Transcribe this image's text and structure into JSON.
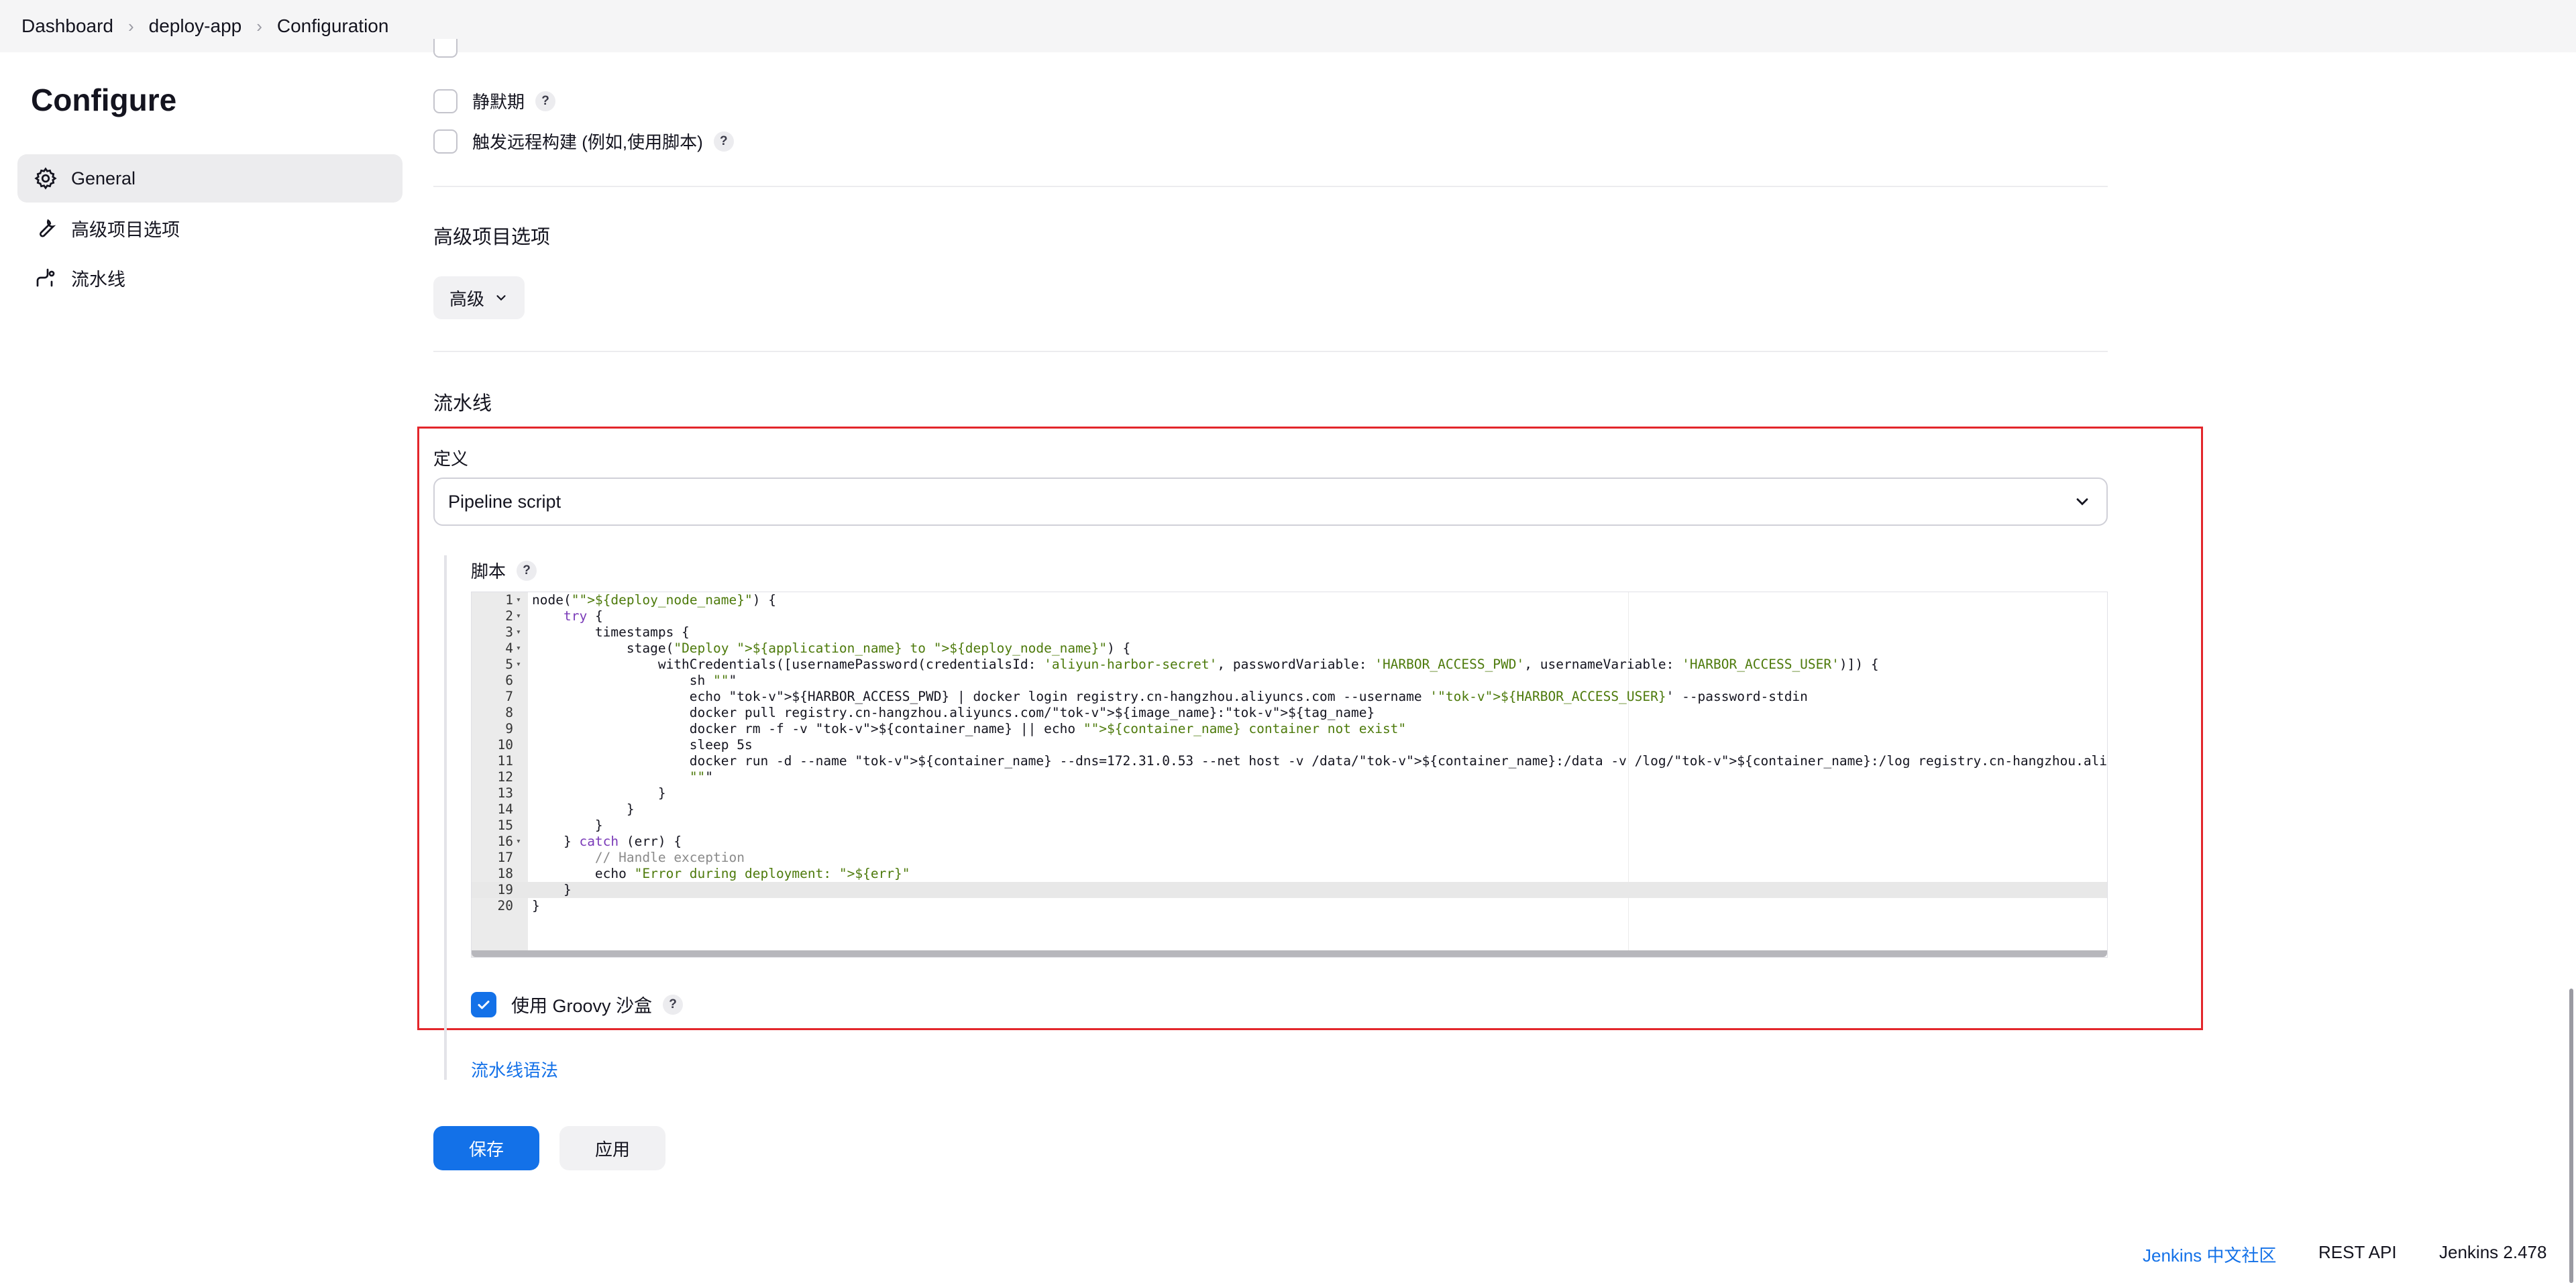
{
  "breadcrumb": {
    "items": [
      "Dashboard",
      "deploy-app",
      "Configuration"
    ]
  },
  "page_title": "Configure",
  "sidebar": {
    "items": [
      {
        "label": "General",
        "icon": "gear-icon",
        "active": true
      },
      {
        "label": "高级项目选项",
        "icon": "wrench-icon",
        "active": false
      },
      {
        "label": "流水线",
        "icon": "pipeline-icon",
        "active": false
      }
    ]
  },
  "triggers": {
    "quiet_period_label": "静默期",
    "remote_build_label": "触发远程构建 (例如,使用脚本)",
    "help_glyph": "?"
  },
  "advanced_section": {
    "title": "高级项目选项",
    "button_label": "高级"
  },
  "pipeline_section": {
    "title": "流水线",
    "definition_label": "定义",
    "definition_value": "Pipeline script",
    "script_label": "脚本",
    "sandbox_label": "使用 Groovy 沙盒",
    "sandbox_checked": true,
    "syntax_link": "流水线语法"
  },
  "editor": {
    "active_line": 19,
    "lines": [
      "node(\"${deploy_node_name}\") {",
      "    try {",
      "        timestamps {",
      "            stage(\"Deploy ${application_name} to ${deploy_node_name}\") {",
      "                withCredentials([usernamePassword(credentialsId: 'aliyun-harbor-secret', passwordVariable: 'HARBOR_ACCESS_PWD', usernameVariable: 'HARBOR_ACCESS_USER')]) {",
      "                    sh \"\"\"",
      "                    echo ${HARBOR_ACCESS_PWD} | docker login registry.cn-hangzhou.aliyuncs.com --username '${HARBOR_ACCESS_USER}' --password-stdin",
      "                    docker pull registry.cn-hangzhou.aliyuncs.com/${image_name}:${tag_name}",
      "                    docker rm -f -v ${container_name} || echo \"${container_name} container not exist\"",
      "                    sleep 5s",
      "                    docker run -d --name ${container_name} --dns=172.31.0.53 --net host -v /data/${container_name}:/data -v /log/${container_name}:/log registry.cn-hangzhou.aliyuncs.com/${image_name}:${",
      "                    \"\"\"",
      "                }",
      "            }",
      "        }",
      "    } catch (err) {",
      "        // Handle exception",
      "        echo \"Error during deployment: ${err}\"",
      "    }",
      "}"
    ],
    "folds": [
      1,
      2,
      3,
      4,
      5,
      16
    ]
  },
  "buttons": {
    "save": "保存",
    "apply": "应用"
  },
  "footer": {
    "community_link": "Jenkins 中文社区",
    "rest_api": "REST API",
    "version": "Jenkins 2.478"
  },
  "colors": {
    "accent": "#1371e8",
    "highlight_border": "#e3262b",
    "string": "#4d7a0b",
    "keyword": "#7a3ab8",
    "variable": "#e07018",
    "comment": "#8a8a8a"
  }
}
